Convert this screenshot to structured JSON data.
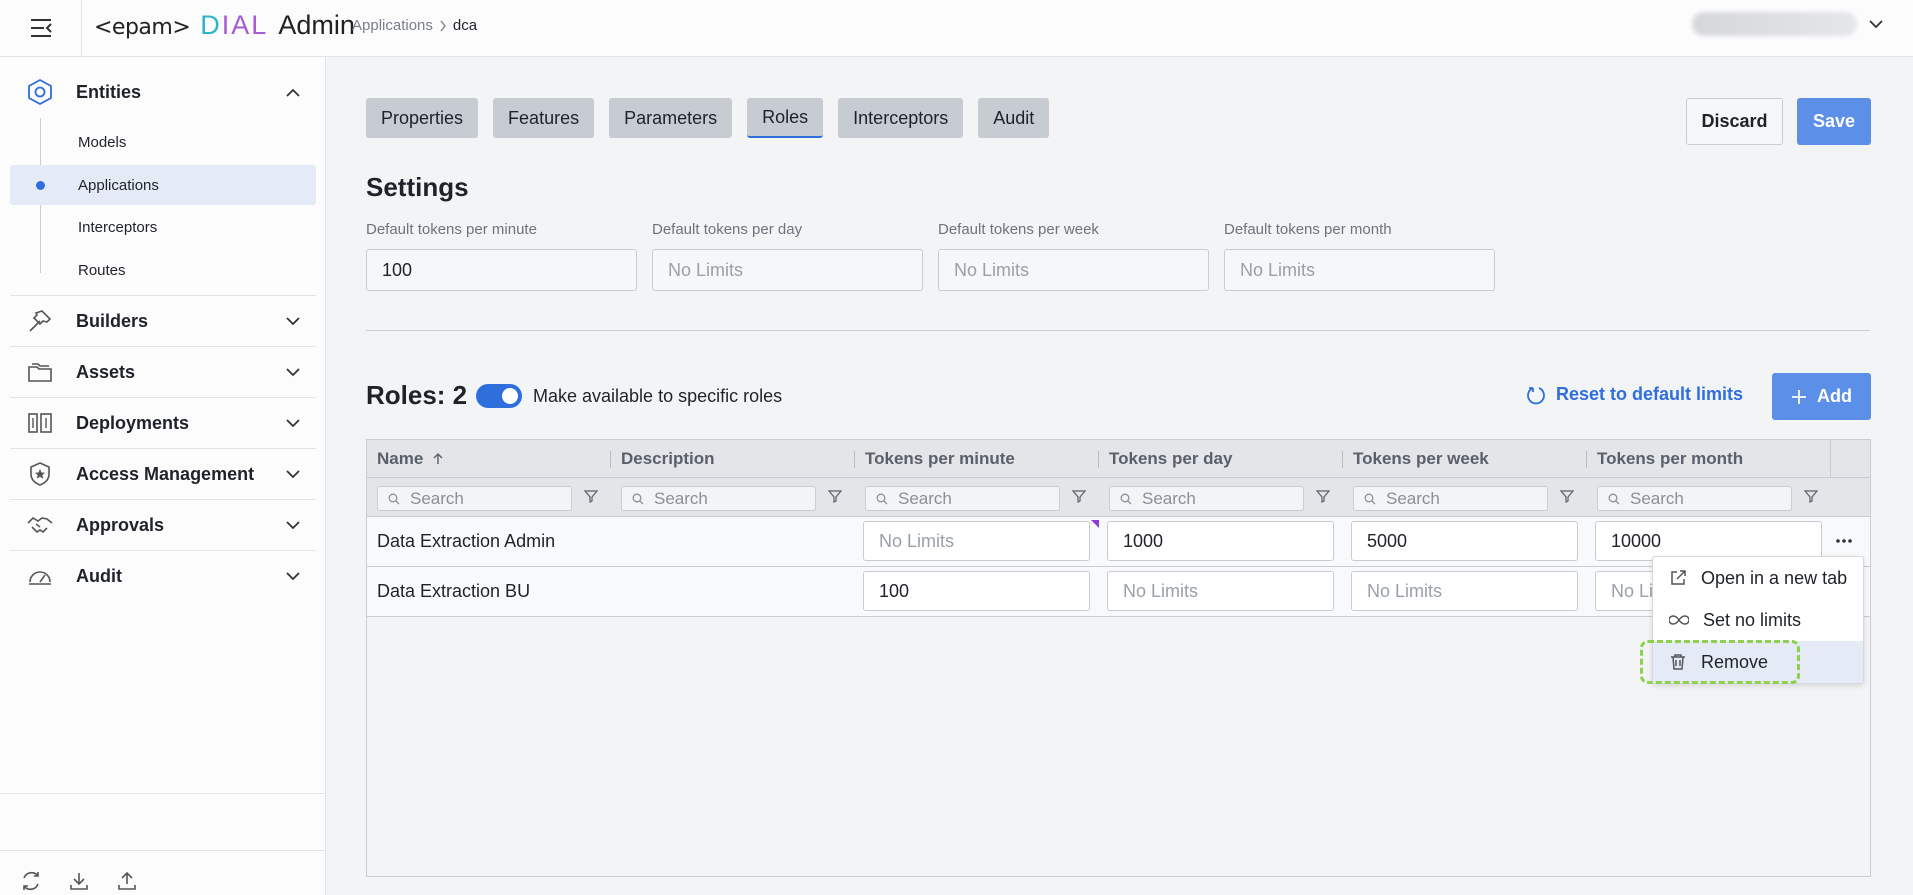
{
  "header": {
    "logo": {
      "epam": "<epam>",
      "dial_d": "D",
      "dial_ial": "IAL",
      "admin": "Admin"
    },
    "breadcrumb": {
      "parent": "Applications",
      "current": "dca"
    }
  },
  "sidebar": {
    "groups": [
      {
        "label": "Entities",
        "icon": "hexagon-icon",
        "expanded": true
      },
      {
        "label": "Builders",
        "icon": "hammer-icon"
      },
      {
        "label": "Assets",
        "icon": "folder-icon"
      },
      {
        "label": "Deployments",
        "icon": "deployments-icon"
      },
      {
        "label": "Access Management",
        "icon": "shield-star-icon"
      },
      {
        "label": "Approvals",
        "icon": "handshake-icon"
      },
      {
        "label": "Audit",
        "icon": "gauge-icon"
      }
    ],
    "entities_items": [
      "Models",
      "Applications",
      "Interceptors",
      "Routes"
    ],
    "active_item": "Applications"
  },
  "tabs": [
    "Properties",
    "Features",
    "Parameters",
    "Roles",
    "Interceptors",
    "Audit"
  ],
  "active_tab": "Roles",
  "actions": {
    "discard": "Discard",
    "save": "Save"
  },
  "settings": {
    "title": "Settings",
    "fields": [
      {
        "label": "Default tokens per minute",
        "value": "100",
        "placeholder": "No Limits"
      },
      {
        "label": "Default tokens per day",
        "value": "",
        "placeholder": "No Limits"
      },
      {
        "label": "Default tokens per week",
        "value": "",
        "placeholder": "No Limits"
      },
      {
        "label": "Default tokens per month",
        "value": "",
        "placeholder": "No Limits"
      }
    ]
  },
  "roles": {
    "title": "Roles: 2",
    "toggle_label": "Make available to specific roles",
    "toggle_on": true,
    "reset_label": "Reset to default limits",
    "add_label": "Add",
    "columns": [
      "Name",
      "Description",
      "Tokens per minute",
      "Tokens per day",
      "Tokens per week",
      "Tokens per month"
    ],
    "filter_placeholder": "Search",
    "rows": [
      {
        "name": "Data Extraction Admin",
        "description": "",
        "per_minute": "No Limits",
        "per_day": "1000",
        "per_week": "5000",
        "per_month": "10000"
      },
      {
        "name": "Data Extraction BU",
        "description": "",
        "per_minute": "100",
        "per_day": "No Limits",
        "per_week": "No Limits",
        "per_month": "No Li"
      }
    ]
  },
  "context_menu": {
    "items": [
      "Open in a new tab",
      "Set no limits",
      "Remove"
    ],
    "highlighted": "Remove"
  },
  "colors": {
    "accent": "#2f6fdc",
    "button_primary": "#5b8fe8",
    "focus_ring": "#8fd14f"
  }
}
